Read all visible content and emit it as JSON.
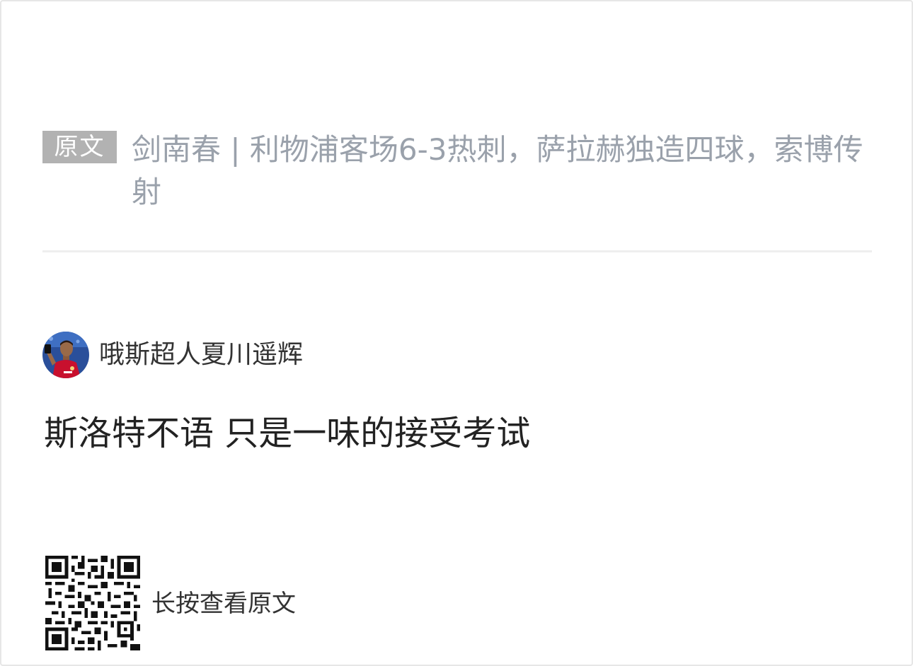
{
  "original": {
    "tag_label": "原文",
    "title": "剑南春 | 利物浦客场6-3热刺，萨拉赫独造四球，索博传射"
  },
  "author": {
    "name": "哦斯超人夏川遥辉",
    "avatar_icon": "avatar-player-icon"
  },
  "comment": {
    "text": "斯洛特不语 只是一味的接受考试"
  },
  "footer": {
    "qr_icon": "qr-code-icon",
    "hint": "长按查看原文"
  },
  "colors": {
    "tag_bg": "#b2b2b2",
    "title_text": "#9aa1ab",
    "body_text": "#222222",
    "divider": "#eeeeee",
    "liverpool_red": "#c8102e",
    "avatar_bg": "#2a4f9a"
  }
}
